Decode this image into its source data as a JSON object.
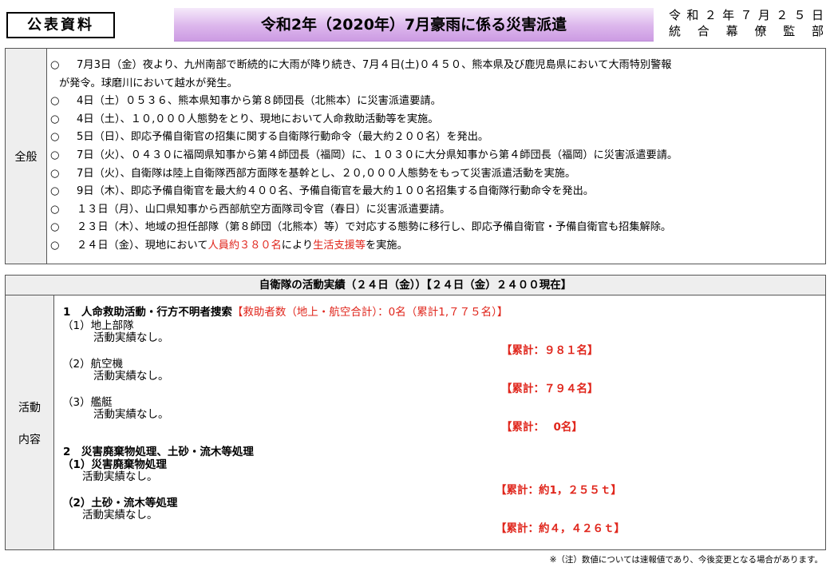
{
  "header": {
    "public_label": "公表資料",
    "title": "令和2年（2020年）7月豪雨に係る災害派遣",
    "date": "令和２年７月２５日",
    "issuer": "統合幕僚監部"
  },
  "general": {
    "label": "全般",
    "items": [
      {
        "bullet": "○",
        "text": "7月3日（金）夜より、九州南部で断続的に大雨が降り続き、7月４日(土)０４５０、熊本県及び鹿児島県において大雨特別警報",
        "cont": "が発令。球磨川において越水が発生。"
      },
      {
        "bullet": "○",
        "text": "4日（土）０５３６、熊本県知事から第８師団長（北熊本）に災害派遣要請。"
      },
      {
        "bullet": "○",
        "text": "4日（土）、１０,０００人態勢をとり、現地において人命救助活動等を実施。"
      },
      {
        "bullet": "○",
        "text": "5日（日）、即応予備自衛官の招集に関する自衛隊行動命令（最大約２００名）を発出。"
      },
      {
        "bullet": "○",
        "text": "7日（火）、０４３０に福岡県知事から第４師団長（福岡）に、１０３０に大分県知事から第４師団長（福岡）に災害派遣要請。"
      },
      {
        "bullet": "○",
        "text": "7日（火）、自衛隊は陸上自衛隊西部方面隊を基幹とし、２０,０００人態勢をもって災害派遣活動を実施。"
      },
      {
        "bullet": "○",
        "text": "9日（木）、即応予備自衛官を最大約４００名、予備自衛官を最大約１００名招集する自衛隊行動命令を発出。"
      },
      {
        "bullet": "○",
        "text": "１３日（月）、山口県知事から西部航空方面隊司令官（春日）に災害派遣要請。"
      },
      {
        "bullet": "○",
        "text": "２３日（木）、地域の担任部隊（第８師団（北熊本）等）で対応する態勢に移行し、即応予備自衛官・予備自衛官も招集解除。"
      },
      {
        "bullet": "○",
        "text_a": "２４日（金）、現地において",
        "text_red1": "人員約３８０名",
        "text_b": "により",
        "text_red2": "生活支援等",
        "text_c": "を実施。"
      }
    ]
  },
  "activity": {
    "header": "自衛隊の活動実績（２４日（金））【２４日（金）２４００現在】",
    "label_line1": "活動",
    "label_line2": "内容",
    "s1_title": "1　人命救助活動・行方不明者捜索",
    "s1_note": "【救助者数（地上・航空合計）：0名（累計1,７７５名）】",
    "ground": "（1）地上部隊",
    "ground_result": "活動実績なし。",
    "ground_total": "【累計：９８１名】",
    "air": "（2）航空機",
    "air_result": "活動実績なし。",
    "air_total": "【累計：７９４名】",
    "ship": "（3）艦艇",
    "ship_result": "活動実績なし。",
    "ship_total": "【累計：　 0名】",
    "s2_title": "2　災害廃棄物処理、土砂・流木等処理",
    "waste": "（1）災害廃棄物処理",
    "waste_result": "活動実績なし。",
    "waste_total": "【累計：約1，２５５ｔ】",
    "soil": "（2）土砂・流木等処理",
    "soil_result": "活動実績なし。",
    "soil_total": "【累計：約４，４２６ｔ】"
  },
  "footnote": "※（注）数値については速報値であり、今後変更となる場合があります。"
}
